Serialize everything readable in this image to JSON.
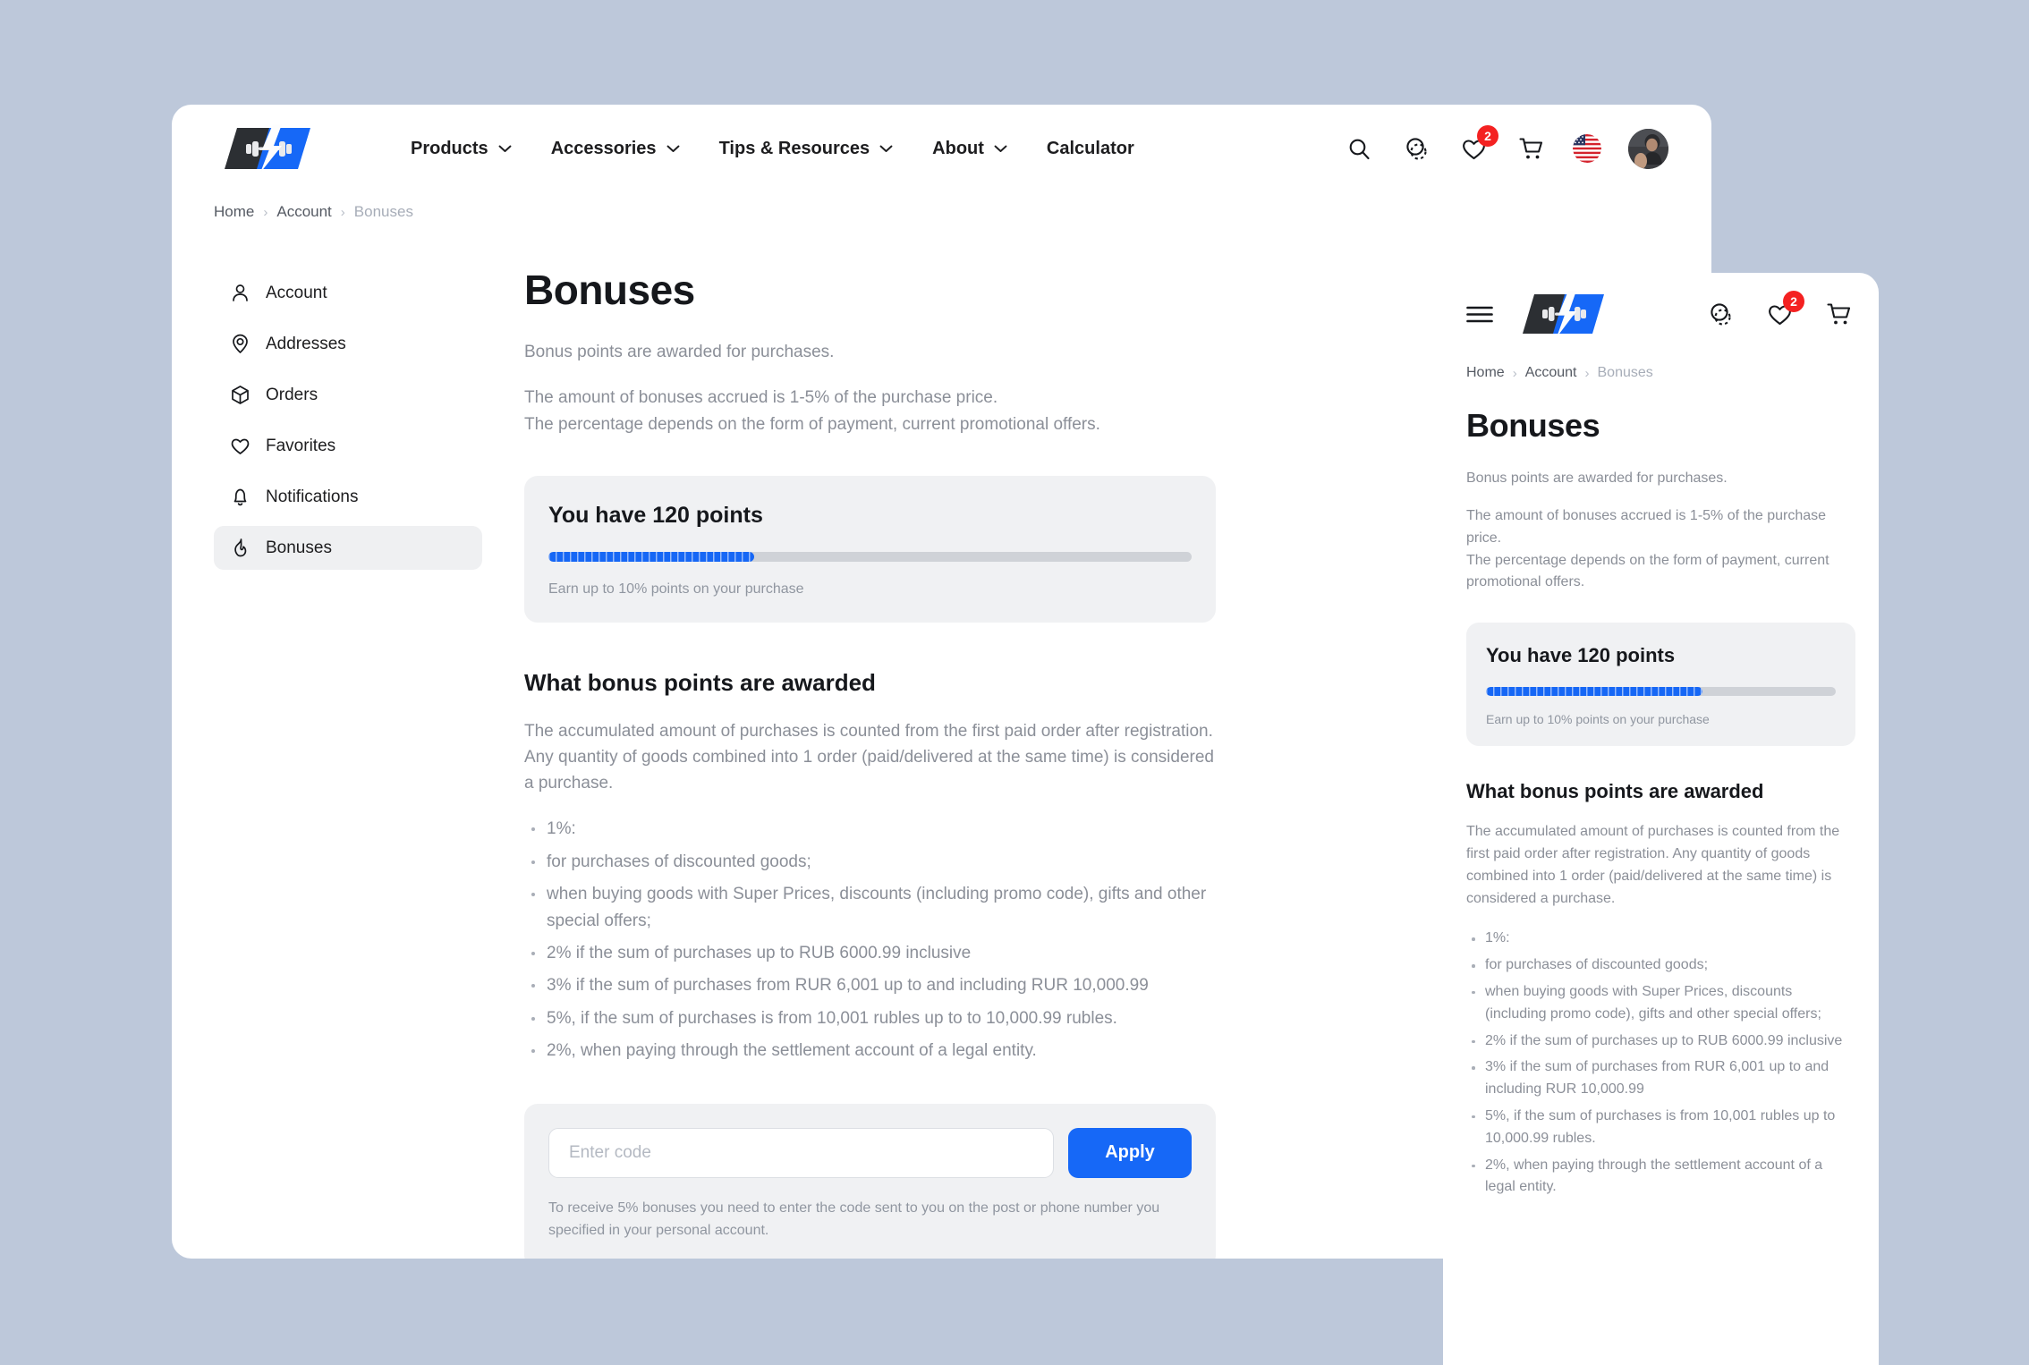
{
  "theme": {
    "page_bg": "#bdc8da",
    "accent_blue": "#1668f7",
    "badge_red": "#f42121",
    "card_gray": "#f0f1f3",
    "muted_text": "#8b8f98"
  },
  "desktop": {
    "nav": [
      {
        "label": "Products",
        "has_chevron": true
      },
      {
        "label": "Accessories",
        "has_chevron": true
      },
      {
        "label": "Tips & Resources",
        "has_chevron": true
      },
      {
        "label": "About",
        "has_chevron": true
      },
      {
        "label": "Calculator",
        "has_chevron": false
      }
    ],
    "actions": {
      "search_icon": "search-icon",
      "compare_icon": "compare-icon",
      "favorites_icon": "heart-icon",
      "favorites_badge": "2",
      "cart_icon": "cart-icon",
      "language_icon": "us-flag-icon",
      "avatar_icon": "user-avatar"
    },
    "breadcrumb": [
      {
        "label": "Home",
        "current": false
      },
      {
        "label": "Account",
        "current": false
      },
      {
        "label": "Bonuses",
        "current": true
      }
    ],
    "breadcrumb_separator": "›",
    "sidebar": [
      {
        "label": "Account",
        "icon": "person-icon",
        "active": false
      },
      {
        "label": "Addresses",
        "icon": "map-pin-icon",
        "active": false
      },
      {
        "label": "Orders",
        "icon": "box-icon",
        "active": false
      },
      {
        "label": "Favorites",
        "icon": "heart-icon",
        "active": false
      },
      {
        "label": "Notifications",
        "icon": "bell-icon",
        "active": false
      },
      {
        "label": "Bonuses",
        "icon": "flame-icon",
        "active": true
      }
    ],
    "page_title": "Bonuses",
    "intro_1": "Bonus points are awarded for purchases.",
    "intro_2a": "The amount of bonuses accrued is 1-5% of the purchase price.",
    "intro_2b": "The percentage depends on the form of payment, current promotional offers.",
    "points_card": {
      "title": "You have 120 points",
      "points": 120,
      "progress_percent": 32,
      "note": "Earn up to 10% points on your purchase"
    },
    "section_title": "What bonus points are awarded",
    "section_para": "The accumulated amount of purchases is counted from the first paid order after registration. Any quantity of goods combined into 1 order (paid/delivered at the same time) is considered a purchase.",
    "bullets": [
      "1%:",
      "for purchases of discounted goods;",
      "when buying goods with Super Prices, discounts (including promo code), gifts and other special offers;",
      "2% if the sum of purchases up to RUB 6000.99 inclusive",
      "3% if the sum of purchases from RUR 6,001 up to and including RUR 10,000.99",
      "5%, if the sum of purchases is from 10,001 rubles up to to 10,000.99 rubles.",
      "2%, when paying through the settlement account of a legal entity."
    ],
    "promo": {
      "placeholder": "Enter code",
      "value": "",
      "apply_label": "Apply",
      "note": "To receive 5% bonuses you need to enter the code sent to you on the post or phone number you specified in your personal account."
    }
  },
  "mobile": {
    "menu_icon": "hamburger-menu-icon",
    "actions": {
      "compare_icon": "compare-icon",
      "favorites_icon": "heart-icon",
      "favorites_badge": "2",
      "cart_icon": "cart-icon"
    },
    "breadcrumb": [
      {
        "label": "Home",
        "current": false
      },
      {
        "label": "Account",
        "current": false
      },
      {
        "label": "Bonuses",
        "current": true
      }
    ],
    "breadcrumb_separator": "›",
    "page_title": "Bonuses",
    "intro_1": "Bonus points are awarded for purchases.",
    "intro_2a": "The amount of bonuses accrued is 1-5% of the purchase price.",
    "intro_2b": "The percentage depends on the form of payment, current promotional offers.",
    "points_card": {
      "title": "You have 120 points",
      "points": 120,
      "progress_percent": 62,
      "note": "Earn up to 10% points on your purchase"
    },
    "section_title": "What bonus points are awarded",
    "section_para": "The accumulated amount of purchases is counted from the first paid order after registration. Any quantity of goods combined into 1 order (paid/delivered at the same time) is considered a purchase.",
    "bullets": [
      "1%:",
      "for purchases of discounted goods;",
      "when buying goods with Super Prices, discounts (including promo code), gifts and other special offers;",
      "2% if the sum of purchases up to RUB 6000.99 inclusive",
      "3% if the sum of purchases from RUR 6,001 up to and including RUR 10,000.99",
      "5%, if the sum of purchases is from 10,001 rubles up to 10,000.99 rubles.",
      "2%, when paying through the settlement account of a legal entity."
    ]
  }
}
